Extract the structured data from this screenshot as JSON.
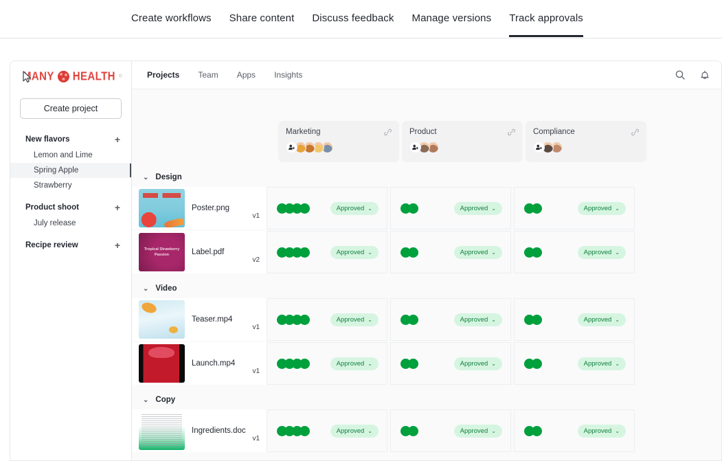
{
  "topnav": {
    "items": [
      {
        "label": "Create workflows",
        "active": false
      },
      {
        "label": "Share content",
        "active": false
      },
      {
        "label": "Discuss feedback",
        "active": false
      },
      {
        "label": "Manage versions",
        "active": false
      },
      {
        "label": "Track approvals",
        "active": true
      }
    ]
  },
  "sidebar": {
    "brand": {
      "word1": "MANY",
      "word2": "HEALTH",
      "trademark": "®",
      "mark_icon": "flower-cluster-icon"
    },
    "create_button": "Create project",
    "groups": [
      {
        "label": "New flavors",
        "add_icon": "plus-icon",
        "items": [
          {
            "label": "Lemon and Lime",
            "selected": false
          },
          {
            "label": "Spring Apple",
            "selected": true
          },
          {
            "label": "Strawberry",
            "selected": false
          }
        ]
      },
      {
        "label": "Product shoot",
        "add_icon": "plus-icon",
        "items": [
          {
            "label": "July release",
            "selected": false
          }
        ]
      },
      {
        "label": "Recipe review",
        "add_icon": "plus-icon",
        "items": []
      }
    ]
  },
  "main": {
    "tabs": [
      {
        "label": "Projects",
        "active": true
      },
      {
        "label": "Team",
        "active": false
      },
      {
        "label": "Apps",
        "active": false
      },
      {
        "label": "Insights",
        "active": false
      }
    ],
    "header_icons": [
      {
        "name": "search-icon"
      },
      {
        "name": "bell-icon"
      }
    ]
  },
  "board": {
    "columns": [
      {
        "title": "Marketing",
        "link_icon": "link-icon",
        "add_member_icon": "add-person-icon",
        "avatar_count": 4,
        "avatar_colors": [
          "#e8a33d",
          "#c9762f",
          "#f2c76b",
          "#7a8fa6"
        ]
      },
      {
        "title": "Product",
        "link_icon": "link-icon",
        "add_member_icon": "add-person-icon",
        "avatar_count": 2,
        "avatar_colors": [
          "#8a6a55",
          "#b07a5a"
        ]
      },
      {
        "title": "Compliance",
        "link_icon": "link-icon",
        "add_member_icon": "add-person-icon",
        "avatar_count": 2,
        "avatar_colors": [
          "#5a4a42",
          "#c08a6a"
        ]
      }
    ],
    "groups": [
      {
        "label": "Design",
        "chevron_icon": "chevron-down-icon",
        "files": [
          {
            "name": "Poster.png",
            "version": "v1",
            "thumb": "th-poster",
            "thumb_text": "",
            "statuses": [
              {
                "dots": 4,
                "label": "Approved",
                "chevron_icon": "chevron-down-icon"
              },
              {
                "dots": 2,
                "label": "Approved",
                "chevron_icon": "chevron-down-icon"
              },
              {
                "dots": 2,
                "label": "Approved",
                "chevron_icon": "chevron-down-icon"
              }
            ]
          },
          {
            "name": "Label.pdf",
            "version": "v2",
            "thumb": "th-label",
            "thumb_text": "Tropical Strawberry Passion",
            "statuses": [
              {
                "dots": 4,
                "label": "Approved",
                "chevron_icon": "chevron-down-icon"
              },
              {
                "dots": 2,
                "label": "Approved",
                "chevron_icon": "chevron-down-icon"
              },
              {
                "dots": 2,
                "label": "Approved",
                "chevron_icon": "chevron-down-icon"
              }
            ]
          }
        ]
      },
      {
        "label": "Video",
        "chevron_icon": "chevron-down-icon",
        "files": [
          {
            "name": "Teaser.mp4",
            "version": "v1",
            "thumb": "th-teaser",
            "thumb_text": "",
            "statuses": [
              {
                "dots": 4,
                "label": "Approved",
                "chevron_icon": "chevron-down-icon"
              },
              {
                "dots": 2,
                "label": "Approved",
                "chevron_icon": "chevron-down-icon"
              },
              {
                "dots": 2,
                "label": "Approved",
                "chevron_icon": "chevron-down-icon"
              }
            ]
          },
          {
            "name": "Launch.mp4",
            "version": "v1",
            "thumb": "th-launch",
            "thumb_text": "",
            "statuses": [
              {
                "dots": 4,
                "label": "Approved",
                "chevron_icon": "chevron-down-icon"
              },
              {
                "dots": 2,
                "label": "Approved",
                "chevron_icon": "chevron-down-icon"
              },
              {
                "dots": 2,
                "label": "Approved",
                "chevron_icon": "chevron-down-icon"
              }
            ]
          }
        ]
      },
      {
        "label": "Copy",
        "chevron_icon": "chevron-down-icon",
        "files": [
          {
            "name": "Ingredients.doc",
            "version": "v1",
            "thumb": "th-doc",
            "thumb_text": "",
            "statuses": [
              {
                "dots": 4,
                "label": "Approved",
                "chevron_icon": "chevron-down-icon"
              },
              {
                "dots": 2,
                "label": "Approved",
                "chevron_icon": "chevron-down-icon"
              },
              {
                "dots": 2,
                "label": "Approved",
                "chevron_icon": "chevron-down-icon"
              }
            ]
          }
        ]
      }
    ]
  },
  "colors": {
    "brand_red": "#dc3c37",
    "approved_pill_bg": "#d6f5e1",
    "approved_pill_text": "#12803f",
    "status_dot_green": "#00a03c",
    "board_bg": "#fafafa"
  }
}
